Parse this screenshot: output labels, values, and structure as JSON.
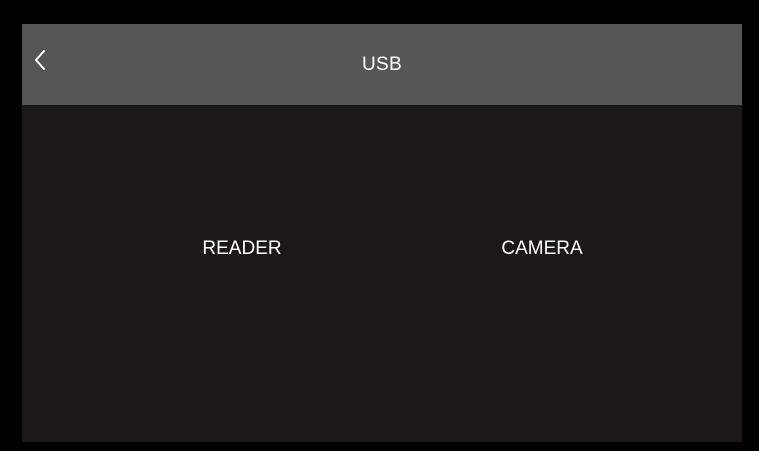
{
  "header": {
    "title": "USB",
    "back_icon": "chevron-left-icon"
  },
  "options": [
    {
      "label": "READER"
    },
    {
      "label": "CAMERA"
    }
  ],
  "colors": {
    "frame": "#000000",
    "header_background": "#565656",
    "screen_background": "#1d1817",
    "text": "#ffffff"
  }
}
